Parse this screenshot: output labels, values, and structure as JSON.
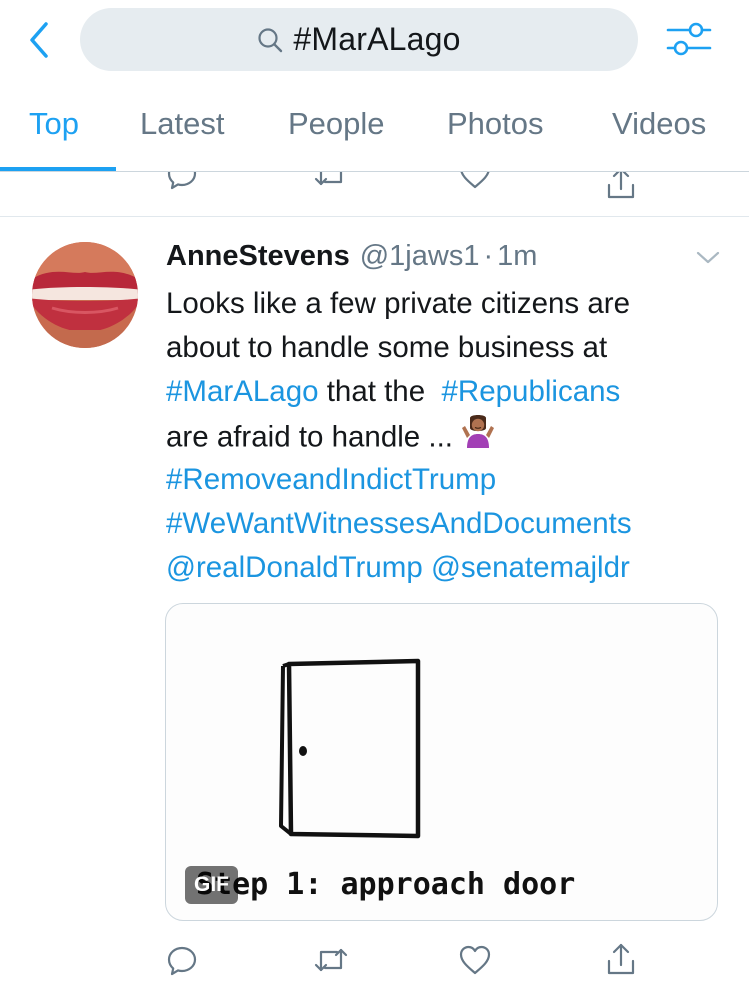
{
  "search": {
    "query": "#MarALago"
  },
  "tabs": [
    {
      "label": "Top",
      "active": true
    },
    {
      "label": "Latest",
      "active": false
    },
    {
      "label": "People",
      "active": false
    },
    {
      "label": "Photos",
      "active": false
    },
    {
      "label": "Videos",
      "active": false
    }
  ],
  "tweet": {
    "display_name": "AnneStevens",
    "handle": "@1jaws1",
    "separator": "·",
    "time": "1m",
    "text_lines": [
      [
        {
          "t": "Looks like a few private citizens are",
          "link": false
        }
      ],
      [
        {
          "t": "about to handle some business at",
          "link": false
        }
      ],
      [
        {
          "t": "#MarALago",
          "link": true
        },
        {
          "t": " that the  ",
          "link": false
        },
        {
          "t": "#Republicans",
          "link": true
        }
      ],
      [
        {
          "t": "are afraid to handle ... ",
          "link": false
        }
      ],
      [
        {
          "t": "#RemoveandIndictTrump",
          "link": true
        }
      ],
      [
        {
          "t": "#WeWantWitnessesAndDocuments",
          "link": true
        }
      ],
      [
        {
          "t": "@realDonaldTrump",
          "link": true
        },
        {
          "t": " ",
          "link": false
        },
        {
          "t": "@senatemajldr",
          "link": true
        }
      ]
    ],
    "emoji": "person-shrugging-emoji",
    "media": {
      "type": "gif",
      "badge": "GIF",
      "caption": "Step 1: approach door"
    }
  },
  "icons": {
    "back": "chevron-left-icon",
    "search": "search-icon",
    "filter": "filter-sliders-icon",
    "reply": "reply-icon",
    "retweet": "retweet-icon",
    "like": "heart-icon",
    "share": "share-icon",
    "caret": "chevron-down-icon"
  },
  "colors": {
    "accent": "#1da1f2",
    "link": "#1b95e0",
    "muted": "#657786",
    "search_bg": "#e6ecf0"
  }
}
